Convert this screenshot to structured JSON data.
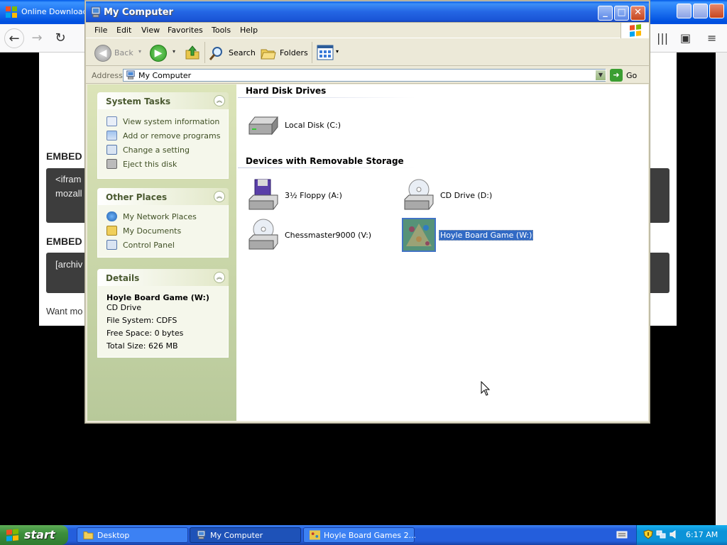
{
  "browser": {
    "title": "Online Download f",
    "embed1_label": "EMBED",
    "embed1_line1": "<ifram",
    "embed1_line2": "mozall",
    "embed2_label": "EMBED",
    "embed2_line1": "[archiv",
    "want_more": "Want mo"
  },
  "window": {
    "title": "My Computer",
    "menu": [
      "File",
      "Edit",
      "View",
      "Favorites",
      "Tools",
      "Help"
    ],
    "toolbar": {
      "back": "Back",
      "search": "Search",
      "folders": "Folders"
    },
    "address": {
      "label": "Address",
      "value": "My Computer",
      "go": "Go"
    }
  },
  "taskpane": {
    "system_tasks": {
      "title": "System Tasks",
      "items": [
        "View system information",
        "Add or remove programs",
        "Change a setting",
        "Eject this disk"
      ]
    },
    "other_places": {
      "title": "Other Places",
      "items": [
        "My Network Places",
        "My Documents",
        "Control Panel"
      ]
    },
    "details": {
      "title": "Details",
      "name": "Hoyle Board Game (W:)",
      "type": "CD Drive",
      "file_system": "File System: CDFS",
      "free_space": "Free Space: 0 bytes",
      "total_size": "Total Size: 626 MB"
    }
  },
  "content": {
    "group_hdd": "Hard Disk Drives",
    "group_removable": "Devices with Removable Storage",
    "drives": {
      "local_c": "Local Disk (C:)",
      "floppy_a": "3½ Floppy (A:)",
      "cd_d": "CD Drive (D:)",
      "chess_v": "Chessmaster9000 (V:)",
      "hoyle_w": "Hoyle Board Game (W:)"
    }
  },
  "taskbar": {
    "start": "start",
    "buttons": [
      "Desktop",
      "My Computer",
      "Hoyle Board Games 2..."
    ],
    "clock": "6:17 AM"
  },
  "colors": {
    "xp_blue": "#245edc",
    "start_green": "#3c8f3c",
    "selection": "#316ac5"
  }
}
